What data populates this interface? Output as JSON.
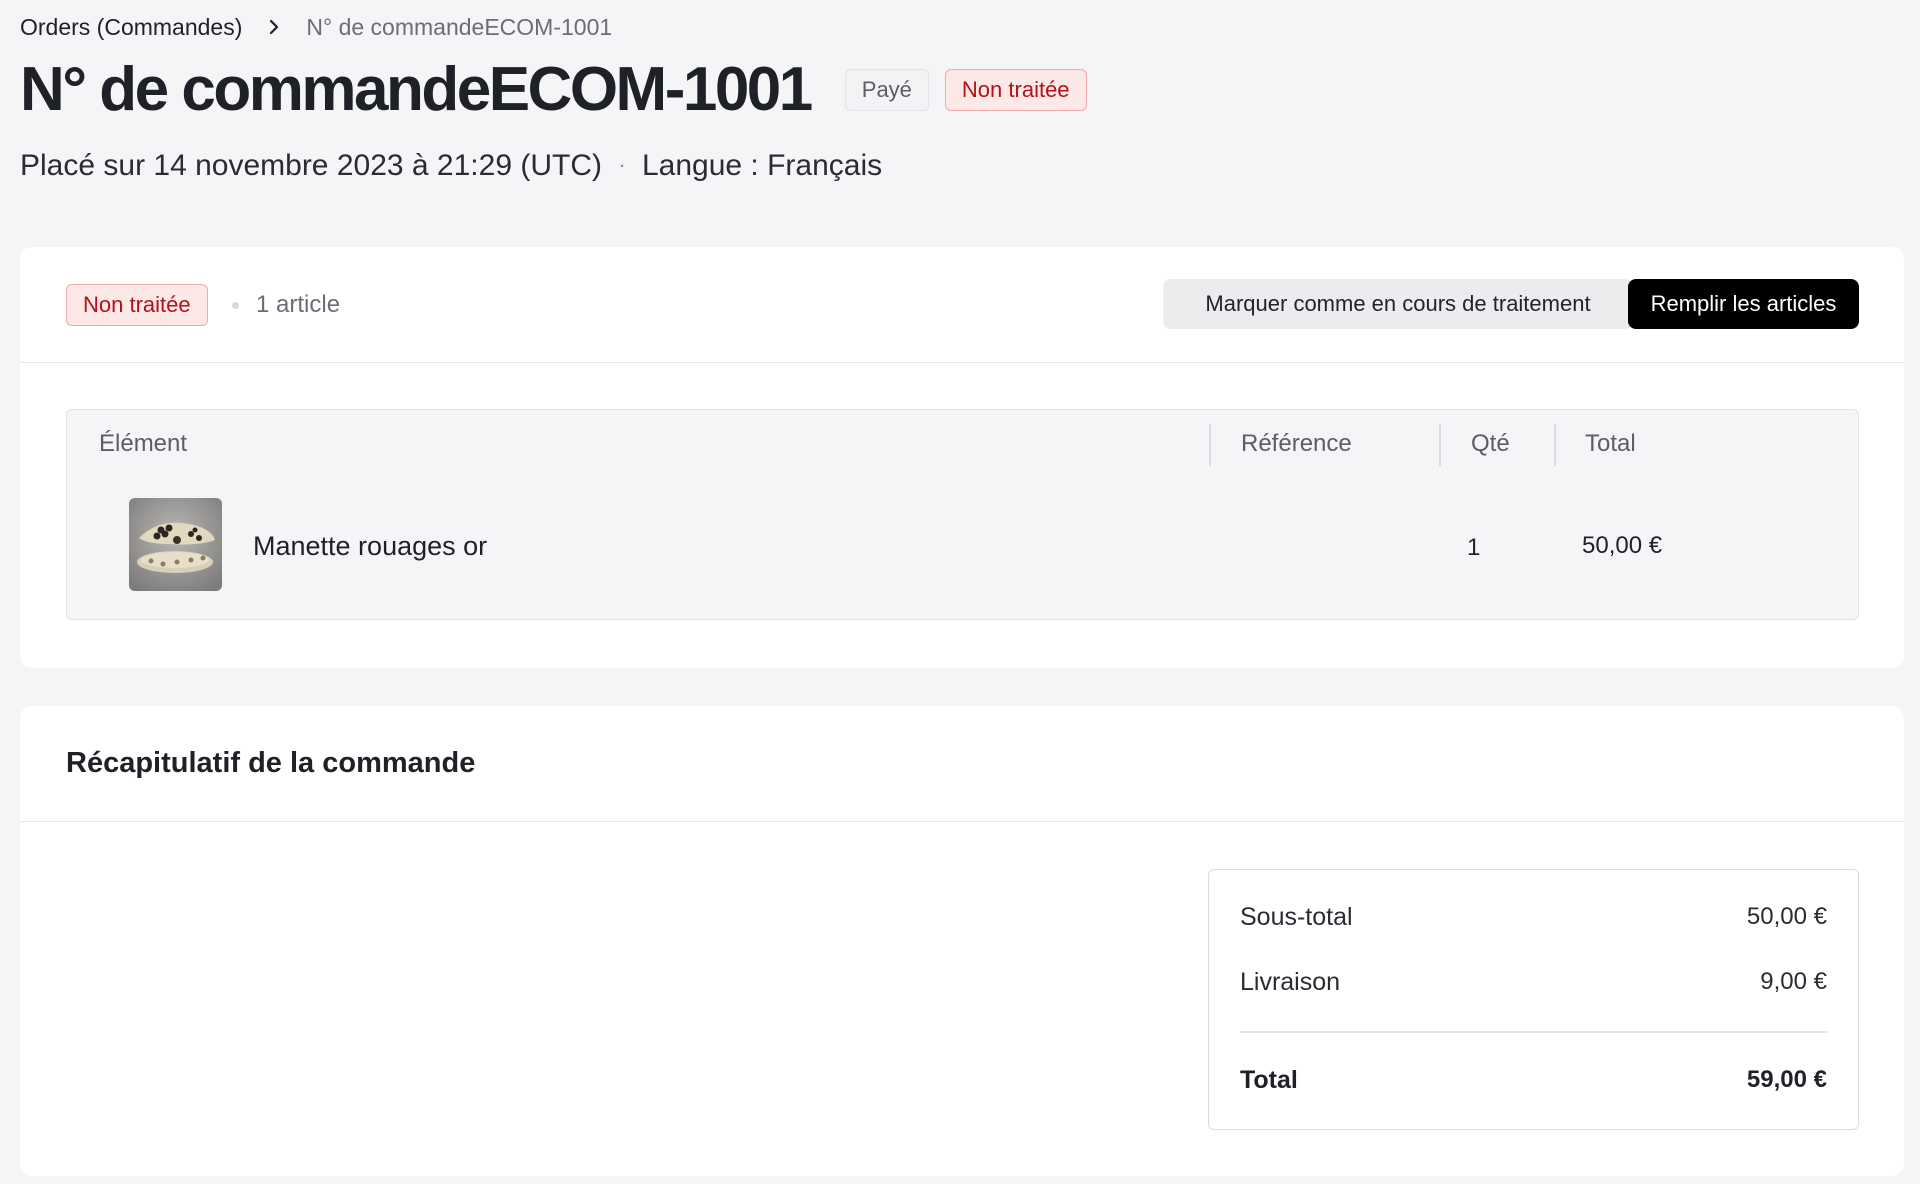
{
  "breadcrumb": {
    "parent": "Orders (Commandes)",
    "current": "N° de commandeECOM-1001"
  },
  "header": {
    "title": "N° de commandeECOM-1001",
    "payment_badge": "Payé",
    "fulfillment_badge": "Non traitée",
    "placed_on": "Placé sur 14 novembre 2023 à 21:29 (UTC)",
    "separator": "·",
    "language": "Langue : Français"
  },
  "items_card": {
    "status": "Non traitée",
    "item_count": "1 article",
    "mark_processing_label": "Marquer comme en cours de traitement",
    "fulfill_label": "Remplir les articles",
    "columns": {
      "element": "Élément",
      "reference": "Référence",
      "quantity": "Qté",
      "total": "Total"
    },
    "rows": [
      {
        "name": "Manette rouages or",
        "reference": "",
        "quantity": "1",
        "total": "50,00 €"
      }
    ]
  },
  "summary": {
    "title": "Récapitulatif de la commande",
    "subtotal_label": "Sous-total",
    "subtotal_value": "50,00 €",
    "shipping_label": "Livraison",
    "shipping_value": "9,00 €",
    "total_label": "Total",
    "total_value": "59,00 €"
  },
  "colors": {
    "background": "#f5f5f7",
    "card": "#ffffff",
    "badge_danger_bg": "#fde8e8",
    "badge_danger_text": "#b3121a",
    "primary_button": "#000000"
  },
  "icons": {
    "breadcrumb_separator": "chevron-right-icon"
  }
}
